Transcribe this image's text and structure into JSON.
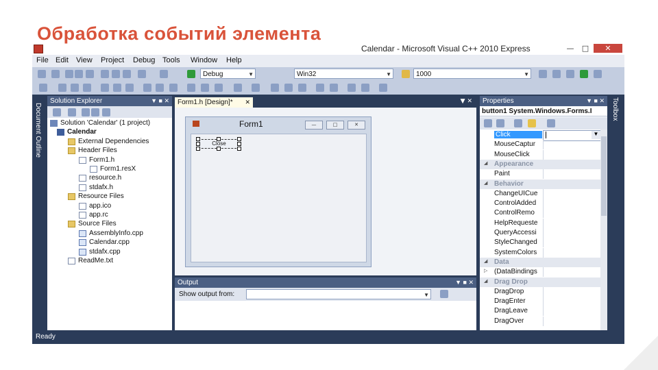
{
  "slide": {
    "title": "Обработка событий элемента"
  },
  "window": {
    "title": "Calendar - Microsoft Visual C++ 2010 Express"
  },
  "menu": [
    "File",
    "Edit",
    "View",
    "Project",
    "Debug",
    "Tools",
    "Window",
    "Help"
  ],
  "toolbar": {
    "config": "Debug",
    "platform": "Win32",
    "find_value": "1000"
  },
  "side_tab": "Document Outline",
  "solution_explorer": {
    "title": "Solution Explorer",
    "items": [
      {
        "label": "Solution 'Calendar' (1 project)",
        "icon": "solution-icon",
        "level": 0
      },
      {
        "label": "Calendar",
        "icon": "project-icon",
        "level": 1,
        "bold": true
      },
      {
        "label": "External Dependencies",
        "icon": "folder-icon",
        "level": 2
      },
      {
        "label": "Header Files",
        "icon": "folder-icon",
        "level": 2
      },
      {
        "label": "Form1.h",
        "icon": "header-file-icon",
        "level": 3
      },
      {
        "label": "Form1.resX",
        "icon": "resource-file-icon",
        "level": 4
      },
      {
        "label": "resource.h",
        "icon": "header-file-icon",
        "level": 3
      },
      {
        "label": "stdafx.h",
        "icon": "header-file-icon",
        "level": 3
      },
      {
        "label": "Resource Files",
        "icon": "folder-icon",
        "level": 2
      },
      {
        "label": "app.ico",
        "icon": "icon-file-icon",
        "level": 3
      },
      {
        "label": "app.rc",
        "icon": "resource-file-icon",
        "level": 3
      },
      {
        "label": "Source Files",
        "icon": "folder-icon",
        "level": 2
      },
      {
        "label": "AssemblyInfo.cpp",
        "icon": "cpp-file-icon",
        "level": 3
      },
      {
        "label": "Calendar.cpp",
        "icon": "cpp-file-icon",
        "level": 3
      },
      {
        "label": "stdafx.cpp",
        "icon": "cpp-file-icon",
        "level": 3
      },
      {
        "label": "ReadMe.txt",
        "icon": "text-file-icon",
        "level": 2
      }
    ]
  },
  "document": {
    "tab": "Form1.h [Design]*",
    "form_title": "Form1",
    "button_text": "Close"
  },
  "output": {
    "title": "Output",
    "show_label": "Show output from:"
  },
  "properties": {
    "title": "Properties",
    "object": "button1 System.Windows.Forms.I",
    "rows": [
      {
        "name": "Click",
        "type": "selected"
      },
      {
        "name": "MouseCaptur",
        "type": "prop"
      },
      {
        "name": "MouseClick",
        "type": "prop"
      },
      {
        "name": "Appearance",
        "type": "category"
      },
      {
        "name": "Paint",
        "type": "prop"
      },
      {
        "name": "Behavior",
        "type": "category"
      },
      {
        "name": "ChangeUICue",
        "type": "prop"
      },
      {
        "name": "ControlAdded",
        "type": "prop"
      },
      {
        "name": "ControlRemo",
        "type": "prop"
      },
      {
        "name": "HelpRequeste",
        "type": "prop"
      },
      {
        "name": "QueryAccessi",
        "type": "prop"
      },
      {
        "name": "StyleChanged",
        "type": "prop"
      },
      {
        "name": "SystemColors",
        "type": "prop"
      },
      {
        "name": "Data",
        "type": "category"
      },
      {
        "name": "(DataBindings",
        "type": "expandable"
      },
      {
        "name": "Drag Drop",
        "type": "category"
      },
      {
        "name": "DragDrop",
        "type": "prop"
      },
      {
        "name": "DragEnter",
        "type": "prop"
      },
      {
        "name": "DragLeave",
        "type": "prop"
      },
      {
        "name": "DragOver",
        "type": "prop"
      }
    ]
  },
  "toolbox_tab": "Toolbox",
  "status": "Ready",
  "colors": {
    "title_accent": "#d9533a",
    "ide_frame": "#2b3c59",
    "selection": "#3399ff"
  }
}
